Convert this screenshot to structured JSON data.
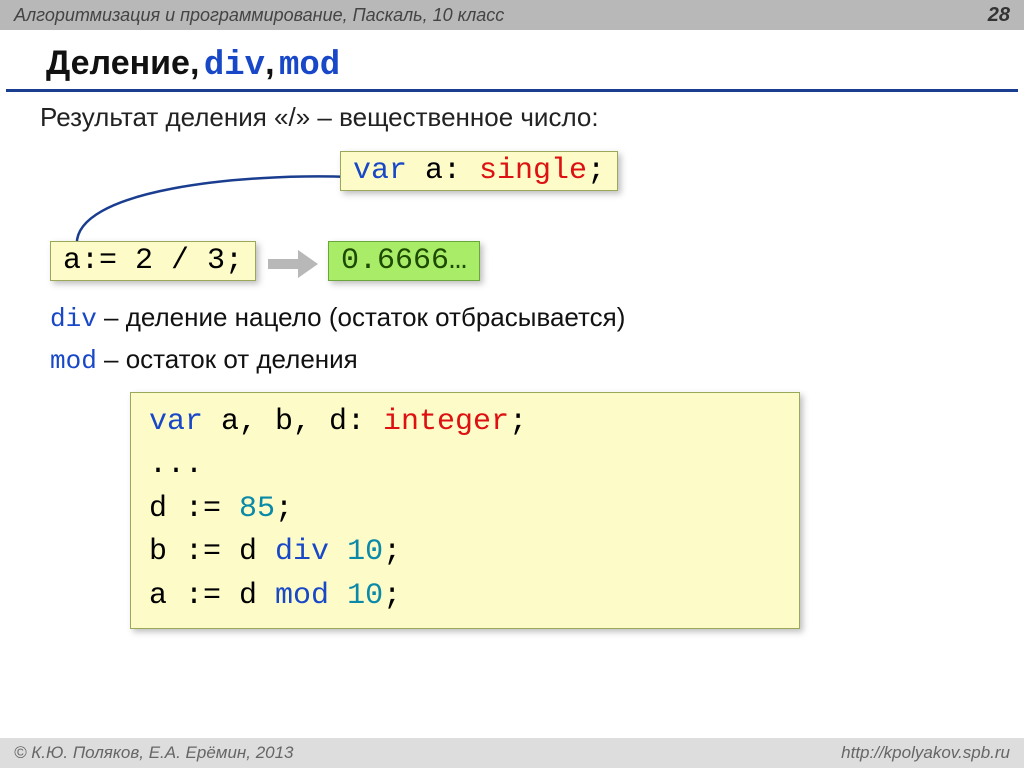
{
  "header": {
    "course": "Алгоритмизация и программирование, Паскаль, 10 класс",
    "page": "28"
  },
  "title": {
    "word": "Деление,",
    "kw1": "div",
    "comma": ",",
    "kw2": "mod"
  },
  "subtitle": "Результат деления «/» – вещественное число:",
  "box_var": {
    "p1": "var",
    "p2": " a: ",
    "p3": "single",
    "p4": ";"
  },
  "box_assign": "a:= 2 / 3;",
  "box_result": "0.6666…",
  "def1": {
    "kw": "div",
    "rest": " – деление нацело (остаток отбрасывается)"
  },
  "def2": {
    "kw": "mod",
    "rest": " – остаток от деления"
  },
  "code": {
    "l1": {
      "a": "var",
      "b": " a, b, d: ",
      "c": "integer",
      "d": ";"
    },
    "l2": "...",
    "l3": {
      "a": "d := ",
      "b": "85",
      "c": ";"
    },
    "l4": {
      "a": "b := d ",
      "b": "div",
      "c": " ",
      "d": "10",
      "e": ";"
    },
    "l5": {
      "a": "a := d ",
      "b": "mod",
      "c": " ",
      "d": "10",
      "e": ";"
    }
  },
  "footer": {
    "left": "© К.Ю. Поляков, Е.А. Ерёмин, 2013",
    "right": "http://kpolyakov.spb.ru"
  }
}
